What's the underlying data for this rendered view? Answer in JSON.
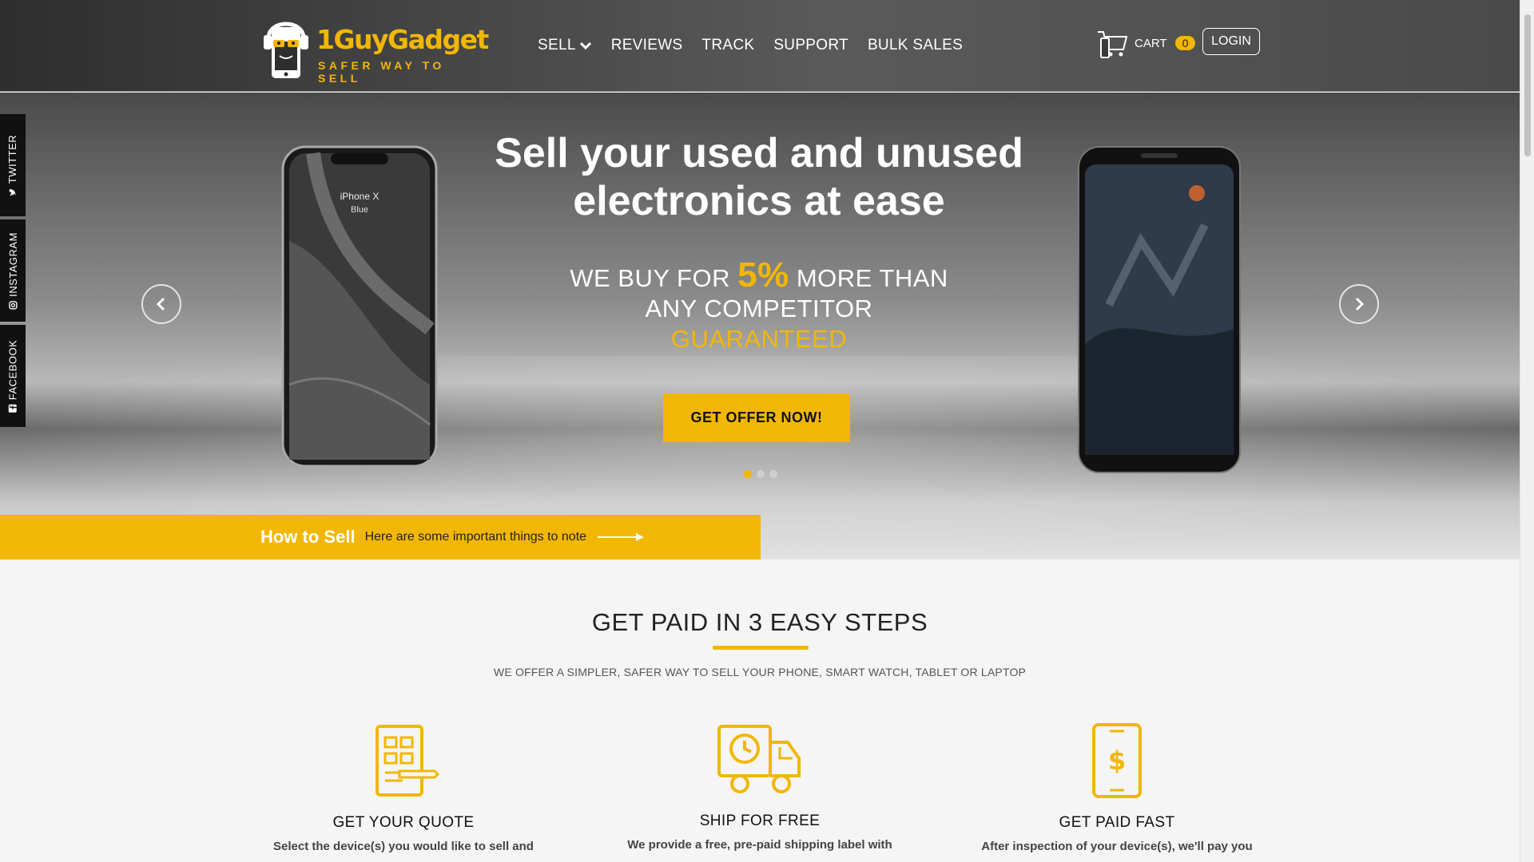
{
  "brand": {
    "name": "1GuyGadget",
    "tagline": "SAFER WAY TO SELL",
    "accent": "#f2b705"
  },
  "nav": [
    {
      "label": "SELL",
      "has_dropdown": true
    },
    {
      "label": "REVIEWS"
    },
    {
      "label": "TRACK"
    },
    {
      "label": "SUPPORT"
    },
    {
      "label": "BULK SALES"
    }
  ],
  "cart": {
    "label": "CART",
    "count": "0",
    "icon": "cart-icon"
  },
  "login": {
    "label": "LOGIN"
  },
  "social": [
    {
      "label": "TWITTER",
      "icon": "twitter-icon"
    },
    {
      "label": "INSTAGRAM",
      "icon": "instagram-icon"
    },
    {
      "label": "FACEBOOK",
      "icon": "facebook-icon"
    }
  ],
  "hero": {
    "title_line1": "Sell your used and unused",
    "title_line2": "electronics at ease",
    "sub_pre": "WE BUY FOR ",
    "sub_pct": "5%",
    "sub_post": " MORE THAN",
    "sub_line2": "ANY COMPETITOR",
    "sub_line3": "GUARANTEED",
    "cta": "GET OFFER NOW!",
    "phone_left_label": "iPhone X",
    "phone_left_color": "Blue",
    "slides": 3,
    "active_slide": 1
  },
  "how_to_sell": {
    "title": "How to Sell",
    "note": "Here are some important things to note"
  },
  "steps": {
    "title": "GET PAID IN 3 EASY STEPS",
    "subtitle": "WE OFFER A SIMPLER, SAFER WAY TO SELL YOUR PHONE, SMART WATCH, TABLET OR LAPTOP",
    "items": [
      {
        "title": "GET YOUR QUOTE",
        "text": "Select the device(s) you would like to sell and",
        "icon": "quote-form-icon"
      },
      {
        "title": "SHIP FOR FREE",
        "text": "We provide a free,  pre-paid shipping label with",
        "icon": "delivery-truck-icon"
      },
      {
        "title": "GET PAID FAST",
        "text": "After inspection of your device(s), we'll pay you",
        "icon": "phone-dollar-icon"
      }
    ]
  }
}
